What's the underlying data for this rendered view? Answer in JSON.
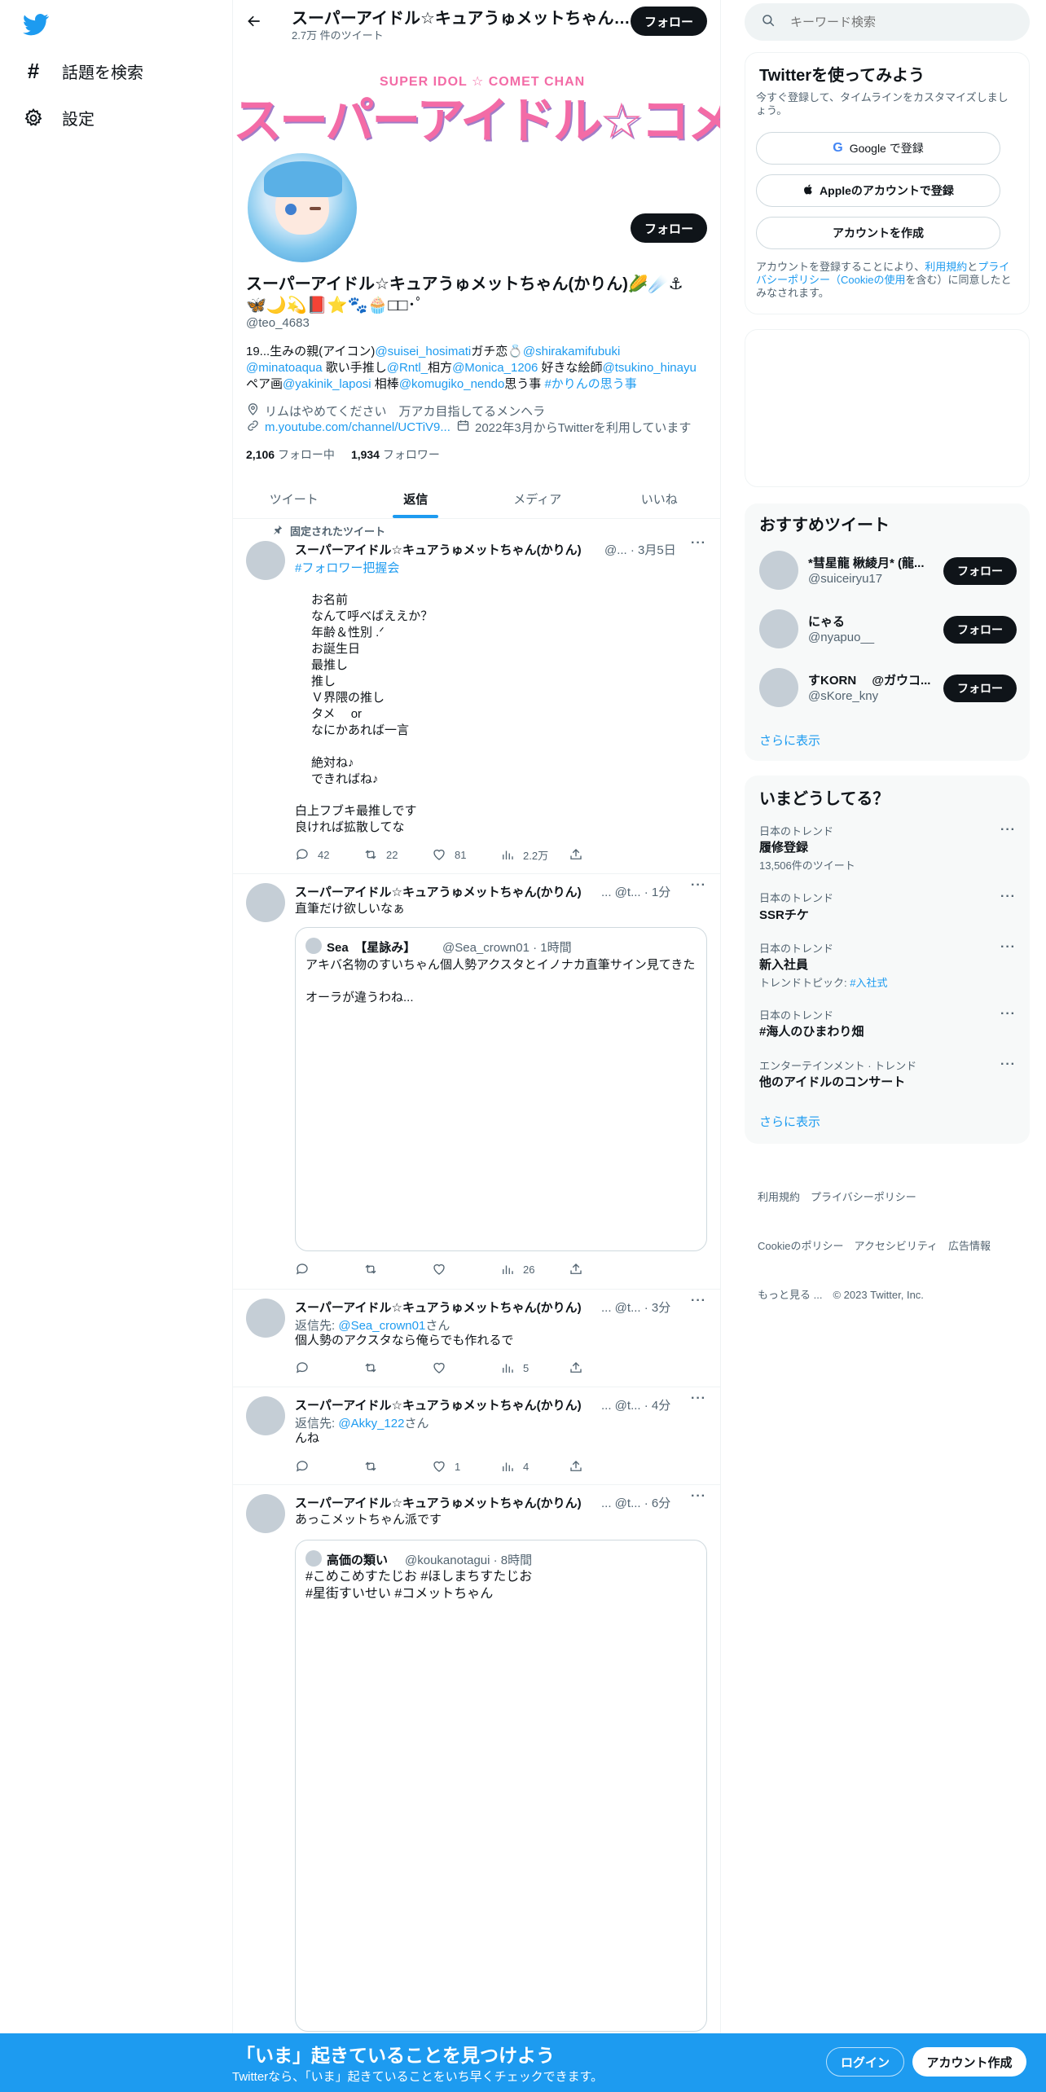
{
  "nav": {
    "search_label": "話題を検索",
    "settings_label": "設定"
  },
  "header": {
    "name": "スーパーアイドル☆キュアうゅメットちゃん(かりん)🌽☄️⚓🦋🌙💫📕⭐🐾🧁",
    "tweet_count": "2.7万 件のツイート",
    "follow_label": "フォロー"
  },
  "banner": {
    "subtitle": "SUPER IDOL ☆ COMET CHAN",
    "title": "スーパーアイドル☆コメットちゃん"
  },
  "profile": {
    "display_name": "スーパーアイドル☆キュアうゅメットちゃん(かりん)🌽☄️⚓",
    "display_name_line2": "🦋🌙💫📕⭐🐾🧁□□･ﾟ",
    "handle": "@teo_4683",
    "follow_label": "フォロー",
    "bio": [
      {
        "t": "19...生みの親(アイコン)",
        "l": false
      },
      {
        "t": "@suisei_hosimati",
        "l": true
      },
      {
        "t": "ガチ恋💍",
        "l": false
      },
      {
        "t": "@shirakamifubuki",
        "l": true
      },
      {
        "t": "\n",
        "l": false
      },
      {
        "t": "@minatoaqua",
        "l": true
      },
      {
        "t": " 歌い手推し",
        "l": false
      },
      {
        "t": "@Rntl_",
        "l": true
      },
      {
        "t": "相方",
        "l": false
      },
      {
        "t": "@Monica_1206",
        "l": true
      },
      {
        "t": " 好きな絵師",
        "l": false
      },
      {
        "t": "@tsukino_hinayu",
        "l": true
      },
      {
        "t": "\n",
        "l": false
      },
      {
        "t": "ペア画",
        "l": false
      },
      {
        "t": "@yakinik_laposi",
        "l": true
      },
      {
        "t": " 相棒",
        "l": false
      },
      {
        "t": "@komugiko_nendo",
        "l": true
      },
      {
        "t": "思う事 ",
        "l": false
      },
      {
        "t": "#かりんの思う事",
        "l": true
      }
    ],
    "location": "リムはやめてください　万アカ目指してるメンヘラ",
    "link": "m.youtube.com/channel/UCTiV9...",
    "joined": "2022年3月からTwitterを利用しています",
    "following_count": "2,106",
    "following_label": "フォロー中",
    "followers_count": "1,934",
    "followers_label": "フォロワー"
  },
  "tabs": [
    {
      "label": "ツイート"
    },
    {
      "label": "返信"
    },
    {
      "label": "メディア"
    },
    {
      "label": "いいね"
    }
  ],
  "tweets": [
    {
      "pinned_label": "固定されたツイート",
      "author": "スーパーアイドル☆キュアうゅメットちゃん(かりん)",
      "meta": "@... · 3月5日",
      "hashtag": "#フォロワー把握会",
      "body1": "お名前\nなんて呼べばええか？\n年齢＆性別 .ᐟ\nお誕生日\n最推し\n推し\nＶ界隈の推し\nタメ　 or\nなにかあれば一言\n\n絶対ね♪\nできればね♪",
      "body2": "白上フブキ最推しです\n良ければ拡散してな",
      "replies": "42",
      "retweets": "22",
      "likes": "81",
      "views": "2.2万"
    },
    {
      "author": "スーパーアイドル☆キュアうゅメットちゃん(かりん)",
      "meta": "... @t... · 1分",
      "body": "直筆だけ欲しいなぁ",
      "quote": {
        "name": "Sea　【星詠み】",
        "handle": "@Sea_crown01 · 1時間",
        "text": "アキバ名物のすいちゃん個人勢アクスタとイノナカ直筆サイン見てきた\n\nオーラが違うわね..."
      },
      "views": "26"
    },
    {
      "author": "スーパーアイドル☆キュアうゅメットちゃん(かりん)",
      "meta": "... @t... · 3分",
      "reply_prefix": "返信先: ",
      "reply_to": "@Sea_crown01",
      "reply_suffix": "さん",
      "body": "個人勢のアクスタなら俺らでも作れるで",
      "views": "5"
    },
    {
      "author": "スーパーアイドル☆キュアうゅメットちゃん(かりん)",
      "meta": "... @t... · 4分",
      "reply_prefix": "返信先: ",
      "reply_to": "@Akky_122",
      "reply_suffix": "さん",
      "body": "んね",
      "likes": "1",
      "views": "4"
    },
    {
      "author": "スーパーアイドル☆キュアうゅメットちゃん(かりん)",
      "meta": "... @t... · 6分",
      "body": "あっこメットちゃん派です",
      "quote": {
        "name": "高価の類い",
        "handle": "@koukanotagui · 8時間",
        "text": "#こめこめすたじお #ほしまちすたじお\n#星街すいせい #コメットちゃん"
      }
    }
  ],
  "search": {
    "placeholder": "キーワード検索"
  },
  "signup": {
    "title": "Twitterを使ってみよう",
    "subtitle": "今すぐ登録して、タイムラインをカスタマイズしましょう。",
    "google_label": "Google で登録",
    "apple_label": "Appleのアカウントで登録",
    "create_label": "アカウントを作成",
    "terms_pre": "アカウントを登録することにより、",
    "terms_link": "利用規約",
    "terms_mid": "と",
    "privacy_link": "プライバシーポリシー（Cookieの使用",
    "terms_post": "を含む）に同意したとみなされます。"
  },
  "recommended": {
    "title": "おすすめツイート",
    "users": [
      {
        "name": "*彗星龍 楸綾月* (龍...",
        "handle": "@suiceiryu17"
      },
      {
        "name": "にゃる",
        "handle": "@nyapuo__"
      },
      {
        "name": "すKORN　 @ガウコ...",
        "handle": "@sKore_kny"
      }
    ],
    "follow_label": "フォロー",
    "more": "さらに表示"
  },
  "trends": {
    "title": "いまどうしてる？",
    "items": [
      {
        "category": "日本のトレンド",
        "name": "履修登録",
        "extra": "13,506件のツイート"
      },
      {
        "category": "日本のトレンド",
        "name": "SSRチケ",
        "extra": ""
      },
      {
        "category": "日本のトレンド",
        "name": "新入社員",
        "extra": "トレンドトピック: ",
        "extra_link": "#入社式"
      },
      {
        "category": "日本のトレンド",
        "name": "#海人のひまわり畑",
        "extra": ""
      },
      {
        "category": "エンターテインメント · トレンド",
        "name": "他のアイドルのコンサート",
        "extra": ""
      }
    ],
    "more": "さらに表示"
  },
  "footer": {
    "line1": "利用規約　プライバシーポリシー",
    "line2": "Cookieのポリシー　アクセシビリティ　広告情報",
    "line3": "もっと見る ...　© 2023 Twitter, Inc."
  },
  "bottom_bar": {
    "title": "「いま」起きていることを見つけよう",
    "subtitle": "Twitterなら、「いま」起きていることをいち早くチェックできます。",
    "login_label": "ログイン",
    "signup_label": "アカウント作成"
  },
  "colors": {
    "accent": "#1d9bf0",
    "dark": "#0f1419",
    "banner_pink": "#f36ba6",
    "banner_purple": "#a07cc8"
  }
}
